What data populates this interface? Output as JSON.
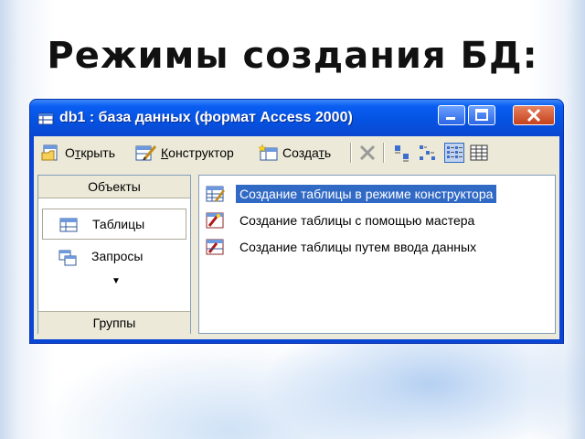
{
  "slide": {
    "title": "Режимы создания БД:"
  },
  "window": {
    "title": "db1 : база данных (формат Access 2000)",
    "icon": "database-icon"
  },
  "toolbar": {
    "open_label_pre": "О",
    "open_label_ul": "т",
    "open_label_post": "крыть",
    "design_label_ul": "К",
    "design_label_post": "онструктор",
    "new_label_pre": "Созда",
    "new_label_ul": "т",
    "new_label_post": "ь"
  },
  "left_pane": {
    "header": "Объекты",
    "items": [
      {
        "label": "Таблицы",
        "icon": "table-icon",
        "selected": true
      },
      {
        "label": "Запросы",
        "icon": "query-icon",
        "selected": false
      }
    ],
    "footer": "Группы"
  },
  "right_pane": {
    "items": [
      {
        "label": "Создание таблицы в режиме конструктора",
        "icon": "design-table-icon",
        "selected": true
      },
      {
        "label": "Создание таблицы с помощью мастера",
        "icon": "wizard-icon",
        "selected": false
      },
      {
        "label": "Создание таблицы путем ввода данных",
        "icon": "datasheet-icon",
        "selected": false
      }
    ]
  },
  "colors": {
    "titlebar": "#0553e3",
    "selection": "#316ac5",
    "client": "#ece9d8"
  }
}
